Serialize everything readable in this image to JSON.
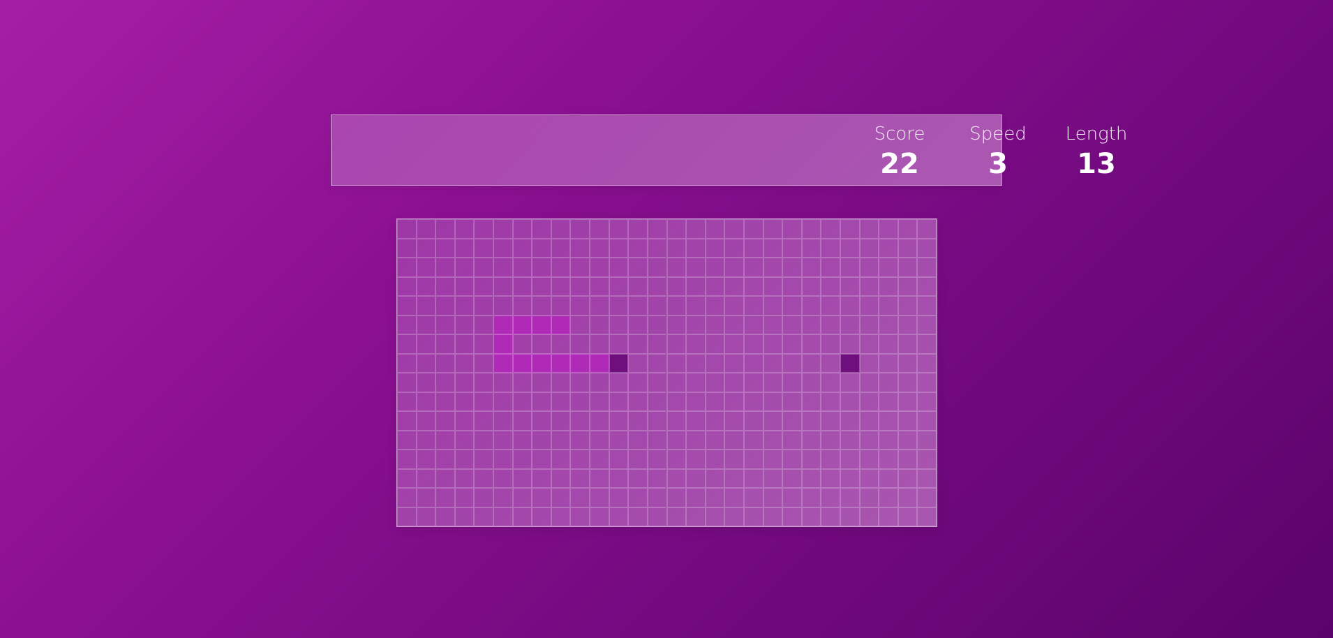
{
  "scoreboard": {
    "score": {
      "label": "Score",
      "value": "22"
    },
    "speed": {
      "label": "Speed",
      "value": "3"
    },
    "length": {
      "label": "Length",
      "value": "13"
    }
  },
  "game": {
    "grid": {
      "cols": 28,
      "rows": 16
    },
    "snake": [
      [
        5,
        5
      ],
      [
        6,
        5
      ],
      [
        7,
        5
      ],
      [
        8,
        5
      ],
      [
        5,
        6
      ],
      [
        5,
        7
      ],
      [
        6,
        7
      ],
      [
        7,
        7
      ],
      [
        8,
        7
      ],
      [
        9,
        7
      ],
      [
        10,
        7
      ]
    ],
    "head": [
      11,
      7
    ],
    "food": [
      23,
      7
    ]
  },
  "colors": {
    "background": "#8a1090",
    "snake_body": "#b02ab8",
    "snake_head": "#6e0f7d",
    "food": "#6e0f7d"
  }
}
